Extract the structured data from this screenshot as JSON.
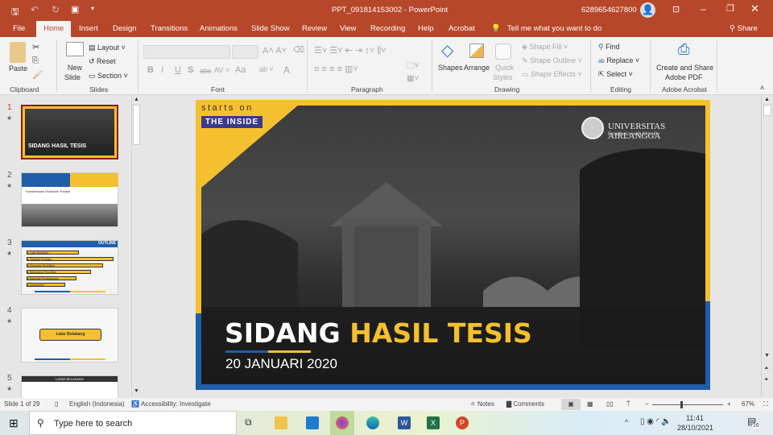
{
  "titlebar": {
    "title": "PPT_091814153002 - PowerPoint",
    "user": "6289654627800"
  },
  "tabs": [
    "File",
    "Home",
    "Insert",
    "Design",
    "Transitions",
    "Animations",
    "Slide Show",
    "Review",
    "View",
    "Recording",
    "Help",
    "Acrobat"
  ],
  "tell_me": "Tell me what you want to do",
  "share": "Share",
  "ribbon": {
    "clipboard": {
      "paste": "Paste",
      "label": "Clipboard"
    },
    "slides": {
      "new_slide": "New",
      "new_slide2": "Slide",
      "layout": "Layout",
      "reset": "Reset",
      "section": "Section",
      "label": "Slides"
    },
    "font": {
      "label": "Font",
      "bold": "B",
      "italic": "I",
      "underline": "U",
      "strike": "S",
      "aa": "Aa",
      "color": "A"
    },
    "paragraph": {
      "label": "Paragraph"
    },
    "drawing": {
      "shapes": "Shapes",
      "arrange": "Arrange",
      "quick": "Quick",
      "styles": "Styles",
      "fill": "Shape Fill",
      "outline": "Shape Outline",
      "effects": "Shape Effects",
      "label": "Drawing"
    },
    "editing": {
      "find": "Find",
      "replace": "Replace",
      "select": "Select",
      "label": "Editing"
    },
    "acrobat": {
      "create": "Create and Share",
      "pdf": "Adobe PDF",
      "label": "Adobe Acrobat"
    }
  },
  "thumbnails": [
    {
      "num": "1",
      "title": "SIDANG HASIL TESIS"
    },
    {
      "num": "2",
      "title": "Karakterisasi Molekuler Parasit"
    },
    {
      "num": "3",
      "title": "OUTLINE",
      "items": [
        "Latar Belakang",
        "Tinjauan Pustaka",
        "Kerangka Penelitian",
        "Metodologi Penelitian",
        "Hasil dan Pembahasan",
        "Kesimpulan"
      ]
    },
    {
      "num": "4",
      "title": "Latar Belakang"
    },
    {
      "num": "5",
      "title": "LATAR BELAKANG"
    }
  ],
  "slide": {
    "tag1": "starts on",
    "tag2": "THE INSIDE",
    "uni": "UNIVERSITAS AIRLANGGA",
    "motto": "Excellence with Morality",
    "title_a": "SIDANG",
    "title_b": "HASIL TESIS",
    "date": "20 JANUARI 2020"
  },
  "status": {
    "slide": "Slide 1 of 29",
    "lang": "English (Indonesia)",
    "access": "Accessibility: Investigate",
    "notes": "Notes",
    "comments": "Comments",
    "zoom": "67%",
    "zoom_fraction": 0.4
  },
  "taskbar": {
    "search": "Type here to search",
    "time": "11:41",
    "date": "28/10/2021",
    "notif": "16"
  },
  "colors": {
    "accent": "#b7472a",
    "yellow": "#f5c02f",
    "blue": "#1f5ea8",
    "navy": "#3a3a8c"
  }
}
